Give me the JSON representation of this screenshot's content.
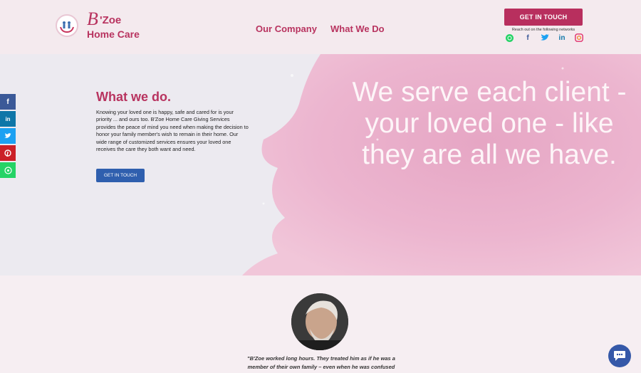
{
  "header": {
    "logo": {
      "b": "B",
      "zoe": "'Zoe",
      "subtitle": "Home Care"
    },
    "nav": {
      "company": "Our Company",
      "what_we_do": "What We Do"
    },
    "cta_label": "GET IN TOUCH",
    "reach_text": "Reach out on the following networks",
    "socials": [
      "whatsapp-icon",
      "facebook-icon",
      "twitter-icon",
      "linkedin-icon",
      "instagram-icon"
    ]
  },
  "share_bar": [
    {
      "icon": "facebook-icon",
      "glyph": "f",
      "color": "#3b5998"
    },
    {
      "icon": "linkedin-icon",
      "glyph": "in",
      "color": "#0e76a8"
    },
    {
      "icon": "twitter-icon",
      "glyph": "t",
      "color": "#1da1f2"
    },
    {
      "icon": "pinterest-icon",
      "glyph": "p",
      "color": "#cb2027"
    },
    {
      "icon": "whatsapp-icon",
      "glyph": "w",
      "color": "#25d366"
    }
  ],
  "hero": {
    "title": "What we do.",
    "paragraph": "Knowing your loved one is happy, safe and cared for is your priority ... and ours too. B'Zoe Home Care Giving Services provides the peace of mind you need when making the decision to honor your family member's wish to remain in their home. Our wide range of customized services ensures your loved one receives the care they both want and need.",
    "button_label": "GET IN TOUCH",
    "quote": "We serve each client - your loved one - like they are all we have."
  },
  "testimonial": {
    "line1": "\"B'Zoe worked long hours. They treated him as if he was a",
    "line2": "member of their own family – even when he was confused"
  },
  "colors": {
    "brand": "#b8335f",
    "button_blue": "#2f5fae",
    "chat": "#3558a8"
  }
}
